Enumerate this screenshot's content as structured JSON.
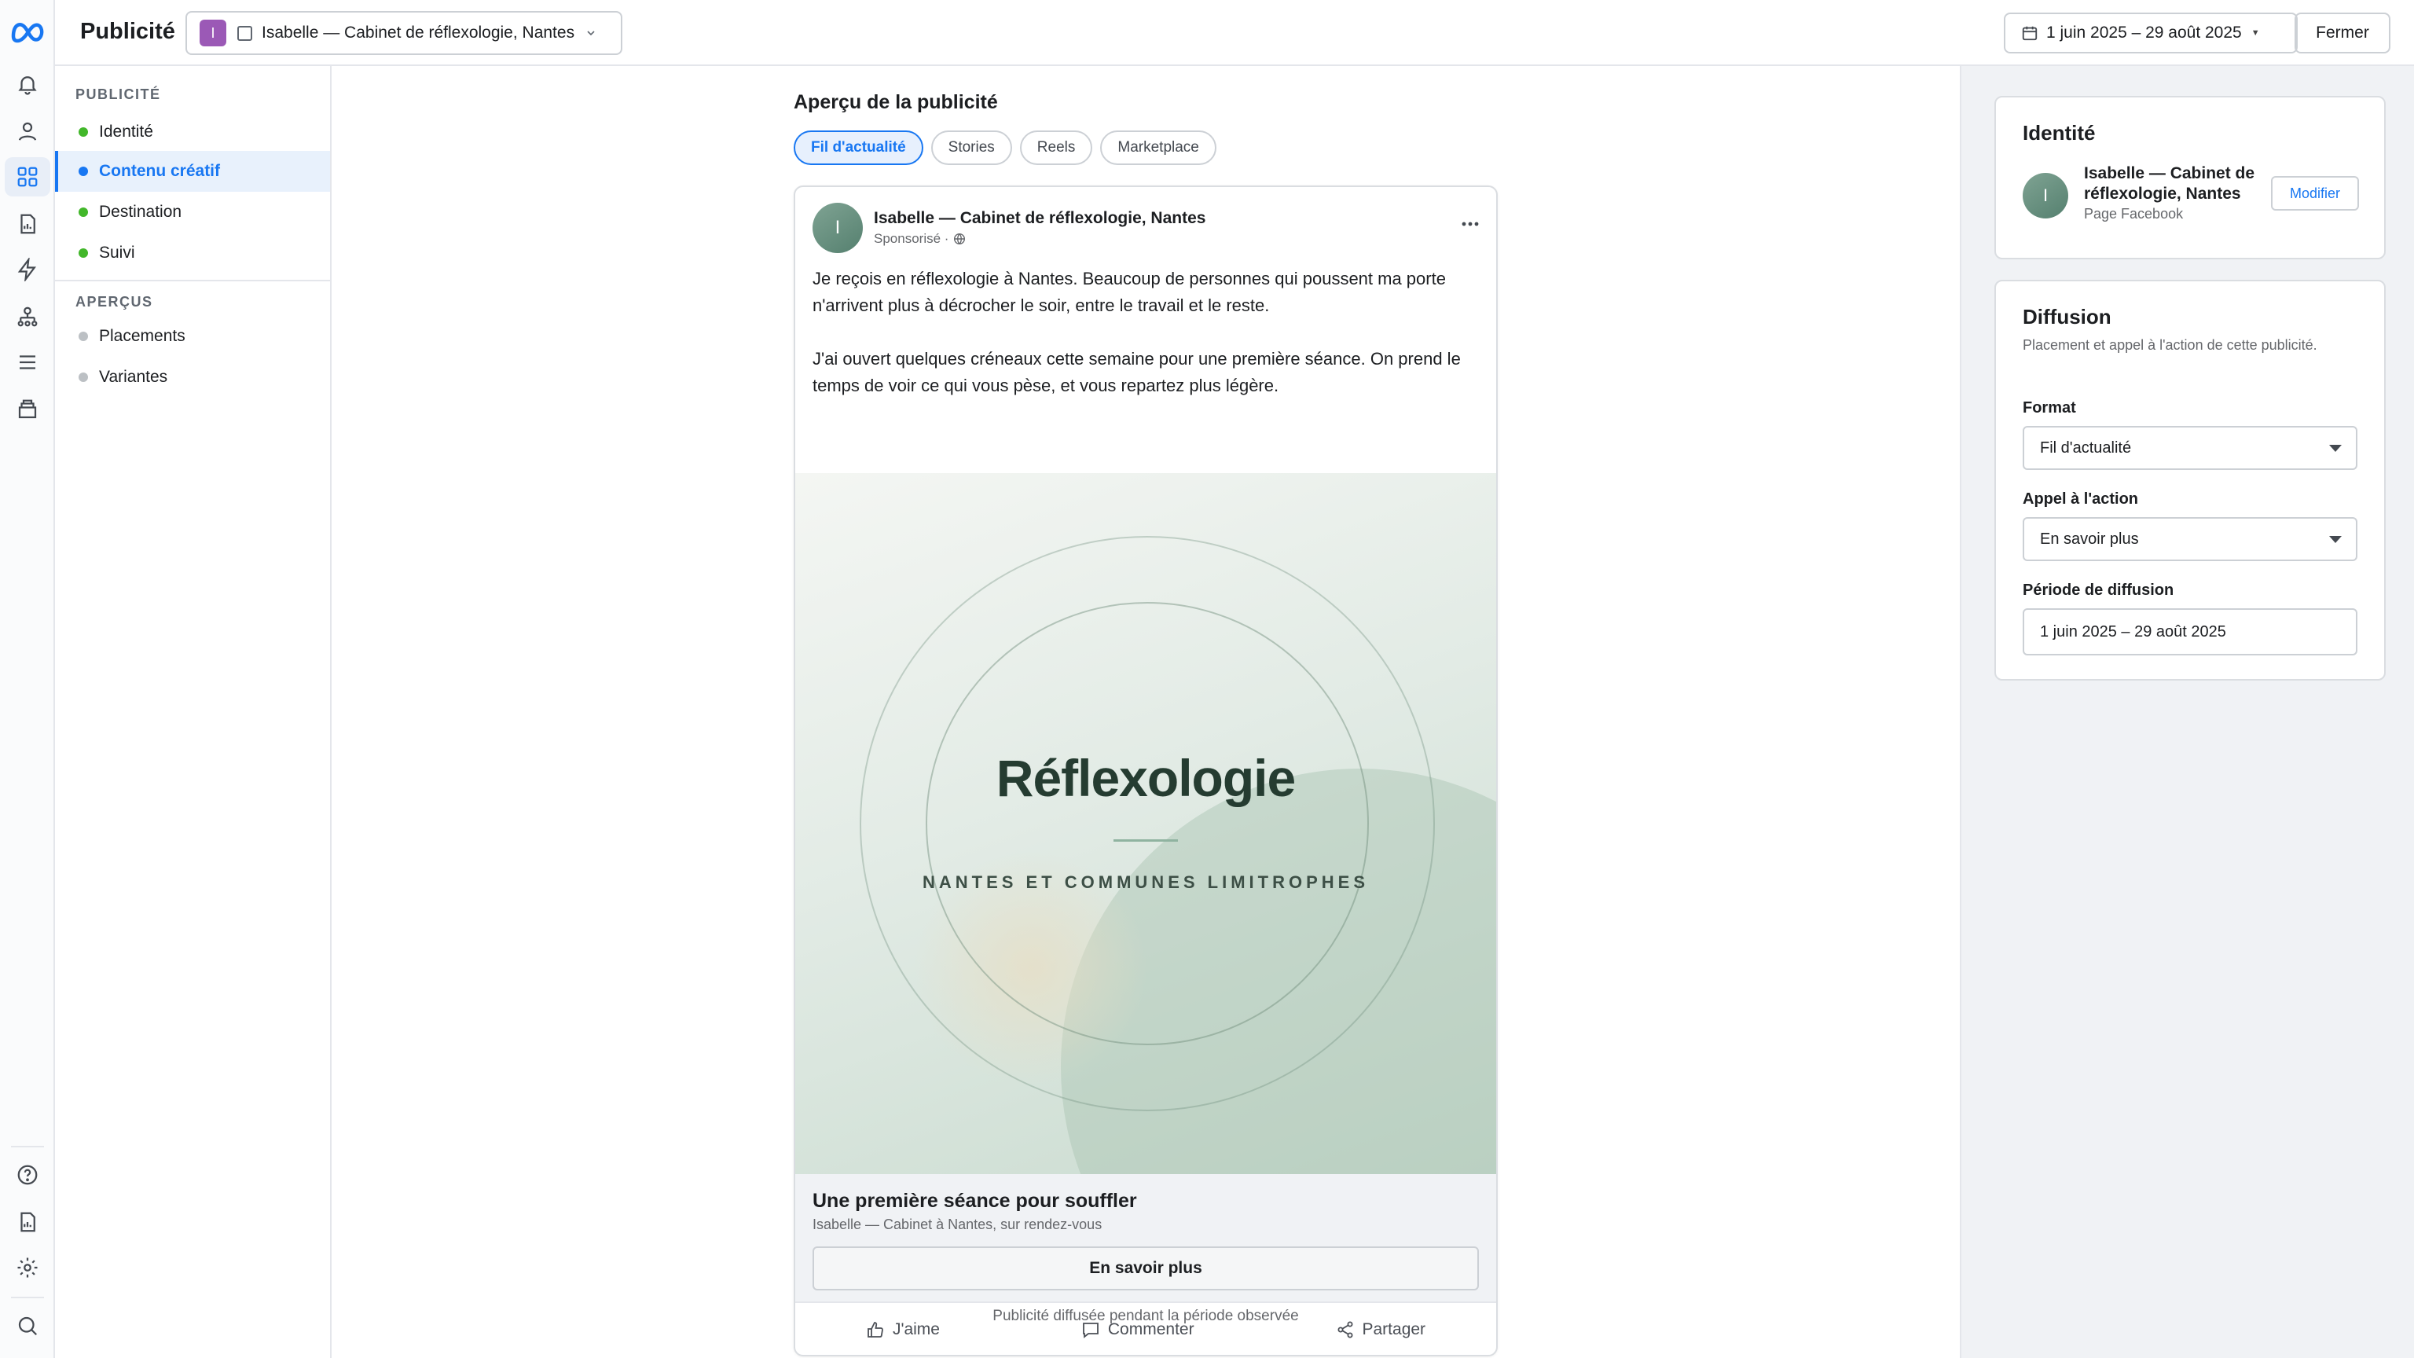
{
  "app": {
    "title": "Publicité",
    "account_initial": "I",
    "account_name": "Isabelle — Cabinet de réflexologie, Nantes",
    "date_range": "1 juin 2025 – 29 août 2025",
    "close_label": "Fermer"
  },
  "rail": {
    "icons": [
      "meta-logo",
      "bell-icon",
      "person-icon",
      "grid-icon",
      "report-icon",
      "lightning-icon",
      "audience-icon",
      "menu-icon",
      "inbox-icon",
      "help-icon",
      "document-icon",
      "gear-icon",
      "search-icon"
    ],
    "active": "grid-icon"
  },
  "leftnav": {
    "section1": "PUBLICITÉ",
    "items1": [
      {
        "label": "Identité",
        "status": "#42b72a"
      },
      {
        "label": "Contenu créatif",
        "status": "#1877f2"
      },
      {
        "label": "Destination",
        "status": "#42b72a"
      },
      {
        "label": "Suivi",
        "status": "#42b72a"
      }
    ],
    "section2": "APERÇUS",
    "items2": [
      {
        "label": "Placements",
        "status": "#bcc0c4"
      },
      {
        "label": "Variantes",
        "status": "#bcc0c4"
      }
    ]
  },
  "preview": {
    "title": "Aperçu de la publicité",
    "tabs": [
      "Fil d'actualité",
      "Stories",
      "Reels",
      "Marketplace"
    ],
    "active_tab": "Fil d'actualité",
    "post": {
      "avatar_initial": "I",
      "page_name": "Isabelle — Cabinet de réflexologie, Nantes",
      "sponsored": "Sponsorisé ·",
      "text_p1": "Je reçois en réflexologie à Nantes. Beaucoup de personnes qui poussent ma porte n'arrivent plus à décrocher le soir, entre le travail et le reste.",
      "text_p2": "J'ai ouvert quelques créneaux cette semaine pour une première séance. On prend le temps de voir ce qui vous pèse, et vous repartez plus légère.",
      "creative_heading": "Réflexologie",
      "creative_sub": "NANTES ET COMMUNES LIMITROPHES",
      "link_title": "Une première séance pour souffler",
      "link_sub": "Isabelle — Cabinet à Nantes, sur rendez-vous",
      "cta": "En savoir plus",
      "actions": [
        "J'aime",
        "Commenter",
        "Partager"
      ]
    },
    "footer_note": "Publicité diffusée pendant la période observée"
  },
  "panel": {
    "identity": {
      "title": "Identité",
      "avatar_initial": "I",
      "name": "Isabelle — Cabinet de réflexologie, Nantes",
      "sub": "Page Facebook",
      "modify": "Modifier"
    },
    "diffusion": {
      "title": "Diffusion",
      "desc": "Placement et appel à l'action de cette publicité.",
      "format_label": "Format",
      "format_value": "Fil d'actualité",
      "cta_label": "Appel à l'action",
      "cta_value": "En savoir plus",
      "period_label": "Période de diffusion",
      "period_value": "1 juin 2025 – 29 août 2025"
    }
  },
  "colors": {
    "accent": "#1877f2",
    "brand_purple": "#9b59b6",
    "creative_green": "#c9dbcf"
  }
}
